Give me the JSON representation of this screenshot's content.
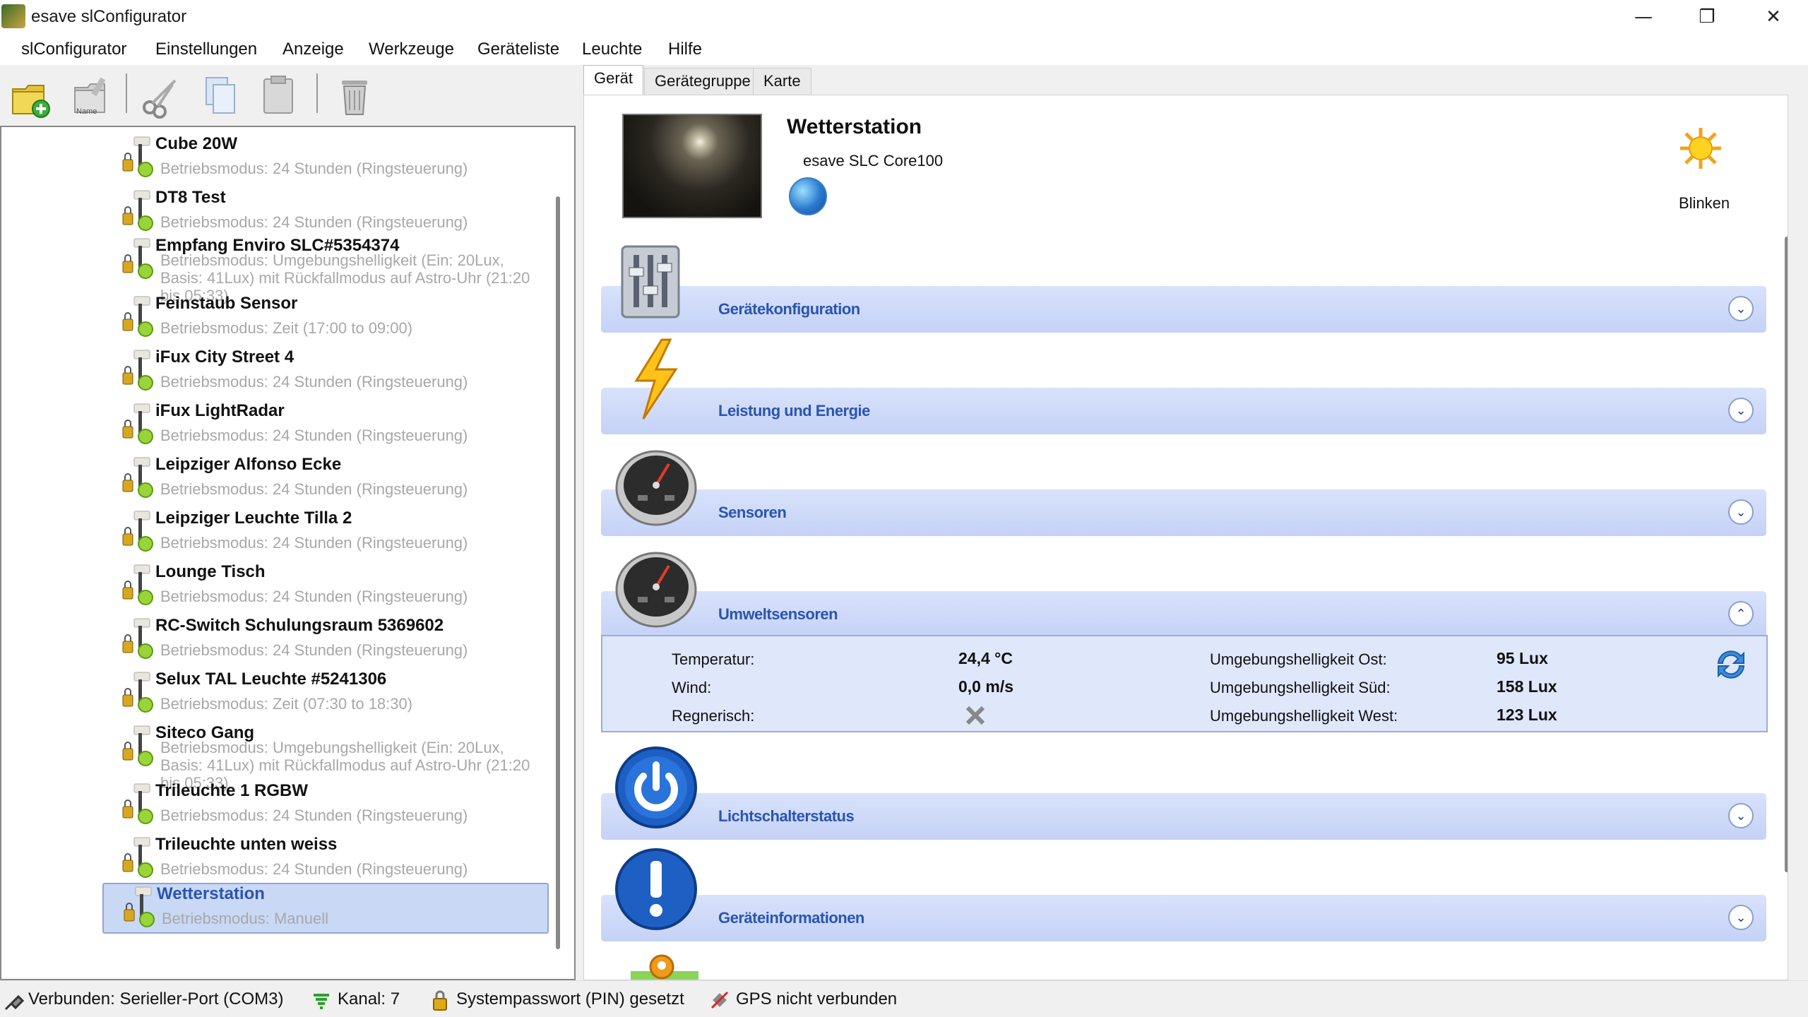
{
  "window": {
    "title": "esave slConfigurator",
    "minimize_glyph": "—",
    "restore_glyph": "❐",
    "close_glyph": "✕"
  },
  "menu": [
    "slConfigurator",
    "Einstellungen",
    "Anzeige",
    "Werkzeuge",
    "Geräteliste",
    "Leuchte",
    "Hilfe"
  ],
  "toolbar": {
    "icons": [
      "add-device-icon",
      "rename-icon",
      "cut-icon",
      "copy-icon",
      "paste-icon",
      "trash-icon"
    ],
    "rename_caption": "Name"
  },
  "device_list": [
    {
      "name": "Cube 20W",
      "mode": "Betriebsmodus: 24 Stunden (Ringsteuerung)"
    },
    {
      "name": "DT8 Test",
      "mode": "Betriebsmodus: 24 Stunden (Ringsteuerung)"
    },
    {
      "name": "Empfang Enviro SLC#5354374",
      "mode": "Betriebsmodus: Umgebungshelligkeit (Ein: 20Lux, Basis: 41Lux) mit Rückfallmodus auf Astro-Uhr (21:20 bis 05:33)"
    },
    {
      "name": "Feinstaub Sensor",
      "mode": "Betriebsmodus: Zeit (17:00 to 09:00)"
    },
    {
      "name": "iFux City Street 4",
      "mode": "Betriebsmodus: 24 Stunden (Ringsteuerung)"
    },
    {
      "name": "iFux LightRadar",
      "mode": "Betriebsmodus: 24 Stunden (Ringsteuerung)"
    },
    {
      "name": "Leipziger Alfonso Ecke",
      "mode": "Betriebsmodus: 24 Stunden (Ringsteuerung)"
    },
    {
      "name": "Leipziger Leuchte Tilla 2",
      "mode": "Betriebsmodus: 24 Stunden (Ringsteuerung)"
    },
    {
      "name": "Lounge Tisch",
      "mode": "Betriebsmodus: 24 Stunden (Ringsteuerung)"
    },
    {
      "name": "RC-Switch Schulungsraum 5369602",
      "mode": "Betriebsmodus: 24 Stunden (Ringsteuerung)"
    },
    {
      "name": "Selux TAL Leuchte #5241306",
      "mode": "Betriebsmodus: Zeit (07:30 to 18:30)"
    },
    {
      "name": "Siteco Gang",
      "mode": "Betriebsmodus: Umgebungshelligkeit (Ein: 20Lux, Basis: 41Lux) mit Rückfallmodus auf Astro-Uhr (21:20 bis 05:33)"
    },
    {
      "name": "Trileuchte 1 RGBW",
      "mode": "Betriebsmodus: 24 Stunden (Ringsteuerung)"
    },
    {
      "name": "Trileuchte unten weiss",
      "mode": "Betriebsmodus: 24 Stunden (Ringsteuerung)"
    },
    {
      "name": "Wetterstation",
      "mode": "Betriebsmodus: Manuell",
      "selected": true
    }
  ],
  "tabs": [
    "Gerät",
    "Gerätegruppe",
    "Karte"
  ],
  "device": {
    "name": "Wetterstation",
    "model": "esave SLC Core100",
    "blink_label": "Blinken"
  },
  "sections": [
    {
      "label": "Gerätekonfiguration",
      "icon": "settings-sliders-icon",
      "expanded": false
    },
    {
      "label": "Leistung und Energie",
      "icon": "lightning-icon",
      "expanded": false
    },
    {
      "label": "Sensoren",
      "icon": "gauge-icon",
      "expanded": false
    },
    {
      "label": "Umweltsensoren",
      "icon": "gauge-icon",
      "expanded": true
    },
    {
      "label": "Lichtschalterstatus",
      "icon": "power-icon",
      "expanded": false
    },
    {
      "label": "Geräteinformationen",
      "icon": "info-exclamation-icon",
      "expanded": false
    }
  ],
  "chevrons": {
    "collapsed": "⌄",
    "expanded": "⌃"
  },
  "environment": {
    "temperature_label": "Temperatur:",
    "temperature_value": "24,4 °C",
    "wind_label": "Wind:",
    "wind_value": "0,0 m/s",
    "rain_label": "Regnerisch:",
    "east_label": "Umgebungshelligkeit Ost:",
    "east_value": "95 Lux",
    "south_label": "Umgebungshelligkeit Süd:",
    "south_value": "158 Lux",
    "west_label": "Umgebungshelligkeit West:",
    "west_value": "123 Lux"
  },
  "status": {
    "connection": "Verbunden: Serieller-Port (COM3)",
    "channel": "Kanal: 7",
    "pin": "Systempasswort (PIN) gesetzt",
    "gps": "GPS nicht verbunden"
  },
  "colors": {
    "accent": "#2a55b0",
    "section_bg": "#c5d2f6",
    "selected_bg": "#c9d8f5"
  }
}
